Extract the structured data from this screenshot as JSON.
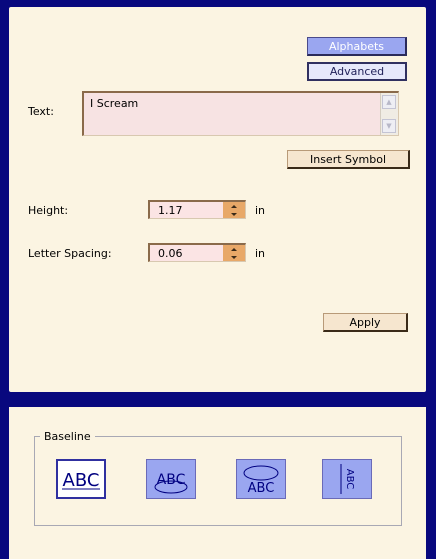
{
  "top_buttons": {
    "alphabets_label": "Alphabets",
    "advanced_label": "Advanced"
  },
  "text_field": {
    "label": "Text:",
    "value": "I Scream"
  },
  "insert_symbol_label": "Insert Symbol",
  "height": {
    "label": "Height:",
    "value": "1.17",
    "unit": "in"
  },
  "letter_spacing": {
    "label": "Letter Spacing:",
    "value": "0.06",
    "unit": "in"
  },
  "apply_label": "Apply",
  "baseline": {
    "title": "Baseline",
    "options": [
      {
        "label": "ABC",
        "icon": "baseline-straight-icon",
        "selected": true
      },
      {
        "label": "ABC",
        "icon": "baseline-arc-top-icon",
        "selected": false
      },
      {
        "label": "ABC",
        "icon": "baseline-arc-bottom-icon",
        "selected": false
      },
      {
        "label": "ABC",
        "icon": "baseline-vertical-icon",
        "selected": false
      }
    ]
  },
  "colors": {
    "background_frame": "#08087e",
    "panel": "#fbf4e2",
    "button_blue": "#9aa6f0",
    "button_tan": "#f6e6cf",
    "spinner_orange": "#e8a868"
  }
}
